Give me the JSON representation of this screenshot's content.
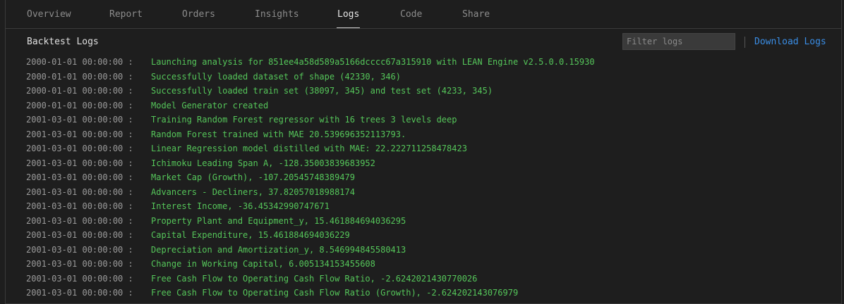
{
  "tabs": [
    {
      "label": "Overview",
      "active": false
    },
    {
      "label": "Report",
      "active": false
    },
    {
      "label": "Orders",
      "active": false
    },
    {
      "label": "Insights",
      "active": false
    },
    {
      "label": "Logs",
      "active": true
    },
    {
      "label": "Code",
      "active": false
    },
    {
      "label": "Share",
      "active": false
    }
  ],
  "panel": {
    "title": "Backtest Logs",
    "filter_placeholder": "Filter logs",
    "filter_value": "",
    "download_label": "Download Logs"
  },
  "colors": {
    "background": "#1e1e1e",
    "log_message": "#55c65a",
    "link": "#3a8ee6",
    "timestamp": "#9a9a9a"
  },
  "logs": [
    {
      "time": "2000-01-01 00:00:00 :",
      "message": "Launching analysis for 851ee4a58d589a5166dcccc67a315910 with LEAN Engine v2.5.0.0.15930"
    },
    {
      "time": "2000-01-01 00:00:00 :",
      "message": "Successfully loaded dataset of shape (42330, 346)"
    },
    {
      "time": "2000-01-01 00:00:00 :",
      "message": "Successfully loaded train set (38097, 345) and test set (4233, 345)"
    },
    {
      "time": "2000-01-01 00:00:00 :",
      "message": "Model Generator created"
    },
    {
      "time": "2001-03-01 00:00:00 :",
      "message": "Training Random Forest regressor with 16 trees 3 levels deep"
    },
    {
      "time": "2001-03-01 00:00:00 :",
      "message": "Random Forest trained with MAE 20.539696352113793."
    },
    {
      "time": "2001-03-01 00:00:00 :",
      "message": "Linear Regression model distilled with MAE: 22.222711258478423"
    },
    {
      "time": "2001-03-01 00:00:00 :",
      "message": "Ichimoku Leading Span A, -128.35003839683952"
    },
    {
      "time": "2001-03-01 00:00:00 :",
      "message": "Market Cap (Growth), -107.20545748389479"
    },
    {
      "time": "2001-03-01 00:00:00 :",
      "message": "Advancers - Decliners, 37.82057018988174"
    },
    {
      "time": "2001-03-01 00:00:00 :",
      "message": "Interest Income, -36.45342990747671"
    },
    {
      "time": "2001-03-01 00:00:00 :",
      "message": "Property Plant and Equipment_y, 15.461884694036295"
    },
    {
      "time": "2001-03-01 00:00:00 :",
      "message": "Capital Expenditure, 15.461884694036229"
    },
    {
      "time": "2001-03-01 00:00:00 :",
      "message": "Depreciation and Amortization_y, 8.546994845580413"
    },
    {
      "time": "2001-03-01 00:00:00 :",
      "message": "Change in Working Capital, 6.005134153455608"
    },
    {
      "time": "2001-03-01 00:00:00 :",
      "message": "Free Cash Flow to Operating Cash Flow Ratio, -2.6242021430770026"
    },
    {
      "time": "2001-03-01 00:00:00 :",
      "message": "Free Cash Flow to Operating Cash Flow Ratio (Growth), -2.624202143076979"
    }
  ]
}
